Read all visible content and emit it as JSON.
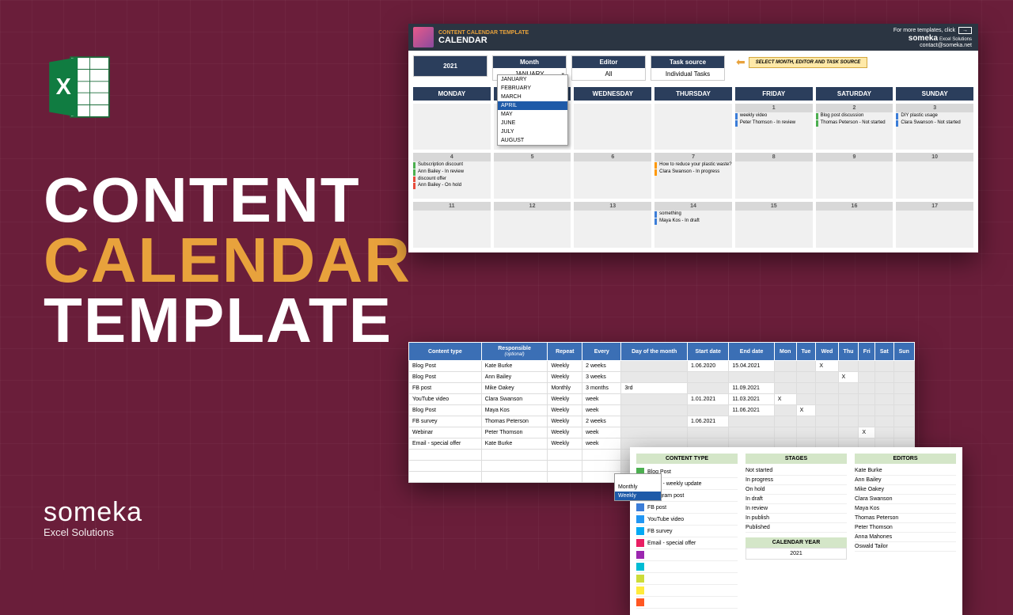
{
  "title": {
    "l1": "CONTENT",
    "l2": "CALENDAR",
    "l3": "TEMPLATE"
  },
  "logo": {
    "brand": "someka",
    "sub": "Excel Solutions"
  },
  "cal": {
    "header": {
      "small": "CONTENT CALENDAR TEMPLATE",
      "big": "CALENDAR",
      "more": "For more templates, click",
      "arrow": "→",
      "brand": "someka",
      "brand_sub": "Excel Solutions",
      "contact": "contact@someka.net"
    },
    "year": "2021",
    "filters": {
      "month": {
        "lbl": "Month",
        "val": "JANUARY"
      },
      "editor": {
        "lbl": "Editor",
        "val": "All"
      },
      "task": {
        "lbl": "Task source",
        "val": "Individual Tasks"
      }
    },
    "hint": "SELECT MONTH, EDITOR AND TASK SOURCE",
    "months": [
      "JANUARY",
      "FEBRUARY",
      "MARCH",
      "APRIL",
      "MAY",
      "JUNE",
      "JULY",
      "AUGUST"
    ],
    "months_sel": "APRIL",
    "days": [
      "MONDAY",
      "TUESDAY",
      "WEDNESDAY",
      "THURSDAY",
      "FRIDAY",
      "SATURDAY",
      "SUNDAY"
    ],
    "cells": {
      "r0c4": {
        "n": "1",
        "e": [
          {
            "c": "b-blue",
            "t": "weekly video"
          },
          {
            "c": "b-blue",
            "t": "Peter Thomson - In review"
          }
        ]
      },
      "r0c5": {
        "n": "2",
        "e": [
          {
            "c": "b-green",
            "t": "Blog post discussion"
          },
          {
            "c": "b-green",
            "t": "Thomas Peterson - Not started"
          }
        ]
      },
      "r0c6": {
        "n": "3",
        "e": [
          {
            "c": "b-blue",
            "t": "DIY plastic usage"
          },
          {
            "c": "b-blue",
            "t": "Clara Swanson - Not started"
          }
        ]
      },
      "r1c0": {
        "n": "4",
        "e": [
          {
            "c": "b-green",
            "t": "Subscription discount"
          },
          {
            "c": "b-green",
            "t": "Ann Bailey - In review"
          },
          {
            "c": "b-red",
            "t": "discount offer"
          },
          {
            "c": "b-red",
            "t": "Ann Bailey - On hold"
          }
        ]
      },
      "r1c1": {
        "n": "5"
      },
      "r1c2": {
        "n": "6"
      },
      "r1c3": {
        "n": "7",
        "e": [
          {
            "c": "b-orange",
            "t": "How to reduce your plastic waste?"
          },
          {
            "c": "b-orange",
            "t": "Clara Swanson - In progress"
          }
        ]
      },
      "r1c4": {
        "n": "8"
      },
      "r1c5": {
        "n": "9"
      },
      "r1c6": {
        "n": "10"
      },
      "r2c0": {
        "n": "11"
      },
      "r2c1": {
        "n": "12"
      },
      "r2c2": {
        "n": "13"
      },
      "r2c3": {
        "n": "14",
        "e": [
          {
            "c": "b-blue",
            "t": "something"
          },
          {
            "c": "b-blue",
            "t": "Maya Kos - In draft"
          }
        ]
      },
      "r2c4": {
        "n": "15"
      },
      "r2c5": {
        "n": "16"
      },
      "r2c6": {
        "n": "17"
      }
    }
  },
  "table": {
    "headers": [
      "Content type",
      "Responsible",
      "Repeat",
      "Every",
      "Day of the month",
      "Start date",
      "End date",
      "Mon",
      "Tue",
      "Wed",
      "Thu",
      "Fri",
      "Sat",
      "Sun"
    ],
    "sub": "(optional)",
    "rows": [
      {
        "ct": "Blog Post",
        "r": "Kate Burke",
        "rp": "Weekly",
        "ev": "2 weeks",
        "dm": "",
        "sd": "1.06.2020",
        "ed": "15.04.2021",
        "d": [
          "",
          "",
          "X",
          "",
          "",
          "",
          ""
        ]
      },
      {
        "ct": "Blog Post",
        "r": "Ann Bailey",
        "rp": "Weekly",
        "ev": "3 weeks",
        "dm": "",
        "sd": "",
        "ed": "",
        "d": [
          "",
          "",
          "",
          "X",
          "",
          "",
          ""
        ]
      },
      {
        "ct": "FB post",
        "r": "Mike Oakey",
        "rp": "Monthly",
        "ev": "3 months",
        "dm": "3rd",
        "sd": "",
        "ed": "11.09.2021",
        "d": [
          "",
          "",
          "",
          "",
          "",
          "",
          ""
        ]
      },
      {
        "ct": "YouTube video",
        "r": "Clara Swanson",
        "rp": "Weekly",
        "ev": "week",
        "dm": "",
        "sd": "1.01.2021",
        "ed": "11.03.2021",
        "d": [
          "X",
          "",
          "",
          "",
          "",
          "",
          ""
        ]
      },
      {
        "ct": "Blog Post",
        "r": "Maya Kos",
        "rp": "Weekly",
        "ev": "week",
        "dm": "",
        "sd": "",
        "ed": "11.06.2021",
        "d": [
          "",
          "X",
          "",
          "",
          "",
          "",
          ""
        ]
      },
      {
        "ct": "FB survey",
        "r": "Thomas Peterson",
        "rp": "Weekly",
        "ev": "2 weeks",
        "dm": "",
        "sd": "1.06.2021",
        "ed": "",
        "d": [
          "",
          "",
          "",
          "",
          "",
          "",
          ""
        ]
      },
      {
        "ct": "Webinar",
        "r": "Peter Thomson",
        "rp": "Weekly",
        "ev": "week",
        "dm": "",
        "sd": "",
        "ed": "",
        "d": [
          "",
          "",
          "",
          "",
          "X",
          "",
          ""
        ]
      },
      {
        "ct": "Email - special offer",
        "r": "Kate Burke",
        "rp": "Weekly",
        "ev": "week",
        "dm": "",
        "sd": "",
        "ed": "",
        "d": [
          "",
          "",
          "",
          "",
          "",
          "",
          ""
        ]
      }
    ],
    "repeat_opts": [
      "",
      "Monthly",
      "Weekly"
    ],
    "repeat_sel": "Weekly"
  },
  "legend": {
    "content_type": {
      "h": "CONTENT TYPE",
      "items": [
        {
          "c": "#4caf50",
          "t": "Blog Post"
        },
        {
          "c": "#8bc34a",
          "t": "Email - weekly update"
        },
        {
          "c": "#ff9800",
          "t": "Instagram post"
        },
        {
          "c": "#3b7dd8",
          "t": "FB post"
        },
        {
          "c": "#2196f3",
          "t": "YouTube video"
        },
        {
          "c": "#03a9f4",
          "t": "FB survey"
        },
        {
          "c": "#e91e63",
          "t": "Email - special offer"
        },
        {
          "c": "#9c27b0",
          "t": ""
        },
        {
          "c": "#00bcd4",
          "t": ""
        },
        {
          "c": "#cddc39",
          "t": ""
        },
        {
          "c": "#ffeb3b",
          "t": ""
        },
        {
          "c": "#ff5722",
          "t": ""
        }
      ]
    },
    "stages": {
      "h": "STAGES",
      "items": [
        "Not started",
        "In progress",
        "On hold",
        "In draft",
        "In review",
        "In publish",
        "Published"
      ]
    },
    "editors": {
      "h": "EDITORS",
      "items": [
        "Kate Burke",
        "Ann Bailey",
        "Mike Oakey",
        "Clara Swanson",
        "Maya Kos",
        "Thomas Peterson",
        "Peter Thomson",
        "Anna Mahones",
        "Oswald Tailor"
      ]
    },
    "calyear": {
      "lbl": "CALENDAR YEAR",
      "val": "2021"
    }
  }
}
